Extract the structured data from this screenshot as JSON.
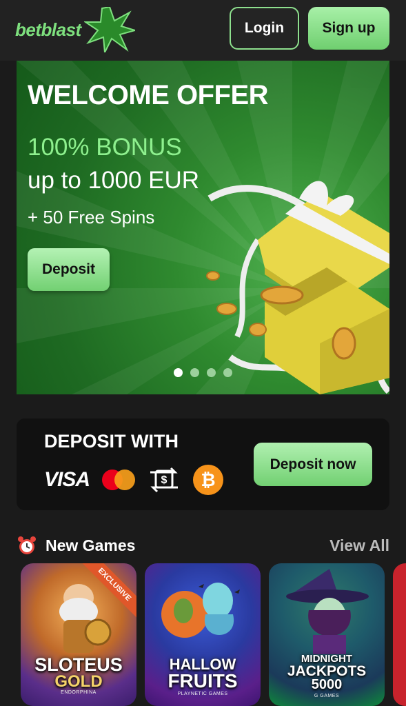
{
  "header": {
    "logo_text": "betblast",
    "login_label": "Login",
    "signup_label": "Sign up"
  },
  "banner": {
    "title": "WELCOME OFFER",
    "bonus": "100% BONUS",
    "amount": "up to 1000 EUR",
    "spins": "+ 50 Free Spins",
    "deposit_label": "Deposit",
    "slides": 4,
    "active_slide": 1
  },
  "deposit_panel": {
    "title": "DEPOSIT WITH",
    "methods": [
      "visa-logo",
      "mastercard-icon",
      "bank-transfer-icon",
      "bitcoin-icon"
    ],
    "visa_text": "VISA",
    "bitcoin_symbol": "₿",
    "button_label": "Deposit now"
  },
  "new_games": {
    "title": "New Games",
    "view_all_label": "View All",
    "games": [
      {
        "name_line1": "SLOTEUS",
        "name_line2": "GOLD",
        "provider": "ENDORPHINA",
        "badge": "EXCLUSIVE"
      },
      {
        "name_line1": "HALLOW",
        "name_line2": "FRUITS",
        "provider": "PLAYNETIC GAMES"
      },
      {
        "name_line1": "MIDNIGHT",
        "name_line2": "JACKPOTS",
        "name_line3": "5000",
        "provider": "G GAMES"
      }
    ]
  },
  "colors": {
    "accent_green": "#7ee07e",
    "button_green": "#8ee08e",
    "background": "#1b1b1b",
    "panel": "#111111",
    "bitcoin": "#f7931a"
  }
}
